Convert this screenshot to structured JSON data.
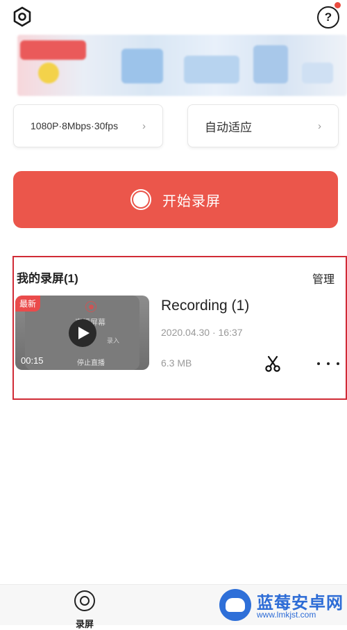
{
  "colors": {
    "accent": "#eb564b",
    "highlight_border": "#d02b36",
    "badge": "#ea4b4b",
    "watermark_blue": "#2d6cd6"
  },
  "topbar": {
    "settings_icon": "hexagon-settings-icon",
    "help_icon": "question-icon",
    "help_glyph": "?"
  },
  "settings": {
    "quality_label": "1080P·8Mbps·30fps",
    "orientation_label": "自动适应",
    "chevron": "›"
  },
  "start_button": {
    "label": "开始录屏"
  },
  "recordings": {
    "title": "我的录屏(1)",
    "manage_label": "管理",
    "items": [
      {
        "badge": "最新",
        "duration": "00:15",
        "thumb_text_1": "直播屏幕",
        "thumb_text_2": "停止直播",
        "thumb_text_3": "录入",
        "title": "Recording (1)",
        "date": "2020.04.30 · 16:37",
        "size": "6.3 MB"
      }
    ]
  },
  "bottom_nav": {
    "record_label": "录屏"
  },
  "watermark": {
    "name": "蓝莓安卓网",
    "url": "www.lmkjst.com"
  }
}
